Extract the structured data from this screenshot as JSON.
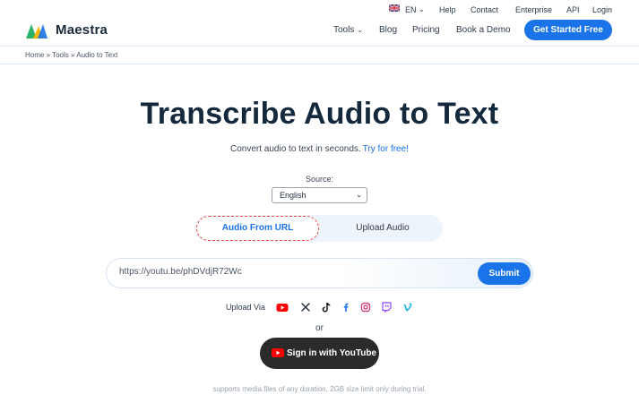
{
  "topbar": {
    "language": "EN",
    "links": [
      "Help",
      "Contact",
      "Enterprise",
      "API",
      "Login"
    ]
  },
  "brand": {
    "name": "Maestra",
    "colors": {
      "green": "#2db26b",
      "yellow": "#f5b800",
      "blue": "#1a73e8"
    }
  },
  "nav": {
    "tools": "Tools",
    "blog": "Blog",
    "pricing": "Pricing",
    "book_demo": "Book a Demo",
    "cta": "Get Started Free"
  },
  "breadcrumb": {
    "items": [
      "Home",
      "Tools",
      "Audio to Text"
    ],
    "separator": " » "
  },
  "hero": {
    "title": "Transcribe Audio to Text",
    "subtitle": "Convert audio to text in seconds.",
    "subtitle_link": "Try for free!"
  },
  "source": {
    "label": "Source:",
    "selected": "English"
  },
  "tabs": {
    "active": "Audio From URL",
    "inactive": "Upload Audio"
  },
  "url_input": {
    "value": "https://youtu.be/phDVdjR72Wc",
    "submit": "Submit"
  },
  "upload_via": {
    "label": "Upload Via",
    "platforms": [
      "youtube-icon",
      "x-icon",
      "tiktok-icon",
      "facebook-icon",
      "instagram-icon",
      "twitch-icon",
      "vimeo-icon"
    ]
  },
  "or_text": "or",
  "youtube_signin": "Sign in with YouTube",
  "footnote": "supports media files of any duration, 2GB size limit only during trial.",
  "colors": {
    "primary": "#1a73e8",
    "dark": "#15293d",
    "tab_dashed": "#e8453c",
    "youtube_red": "#ff0000"
  }
}
